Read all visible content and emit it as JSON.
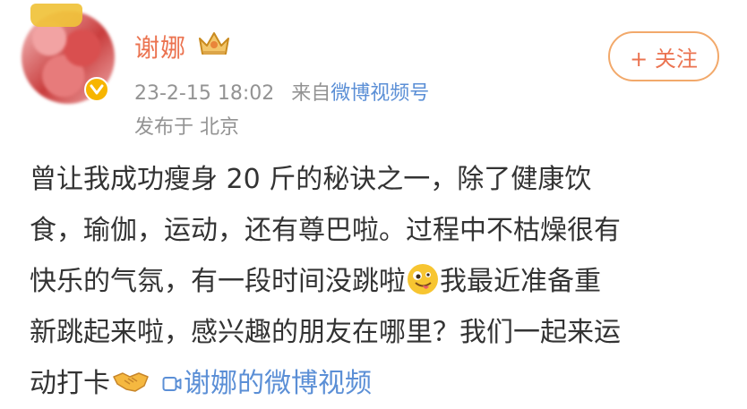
{
  "post": {
    "author": {
      "name": "谢娜",
      "badge_icon": "crown-icon",
      "verified_icon": "verified-badge-icon",
      "verified_color": "#f7b500"
    },
    "follow_button": {
      "label": "+ 关注"
    },
    "meta": {
      "time": "23-2-15 18:02",
      "source_prefix": "来自",
      "source_name": "微博视频号",
      "location": "发布于 北京"
    },
    "content": {
      "line1": "曾让我成功瘦身 20 斤的秘诀之一，除了健康饮",
      "line2": "食，瑜伽，运动，还有尊巴啦。过程中不枯燥很有",
      "line3_a": "快乐的气氛，有一段时间没跳啦",
      "emoji_1": "crazy-face-emoji",
      "line3_b": "我最近准备重",
      "line4": "新跳起来啦，感兴趣的朋友在哪里？我们一起来运",
      "line5_a": "动打卡",
      "emoji_2": "handshake-emoji",
      "video_link": "谢娜的微博视频",
      "video_icon": "video-icon"
    }
  },
  "colors": {
    "accent": "#eb7350",
    "link": "#5b8fd6",
    "text": "#333333",
    "meta": "#939393"
  }
}
